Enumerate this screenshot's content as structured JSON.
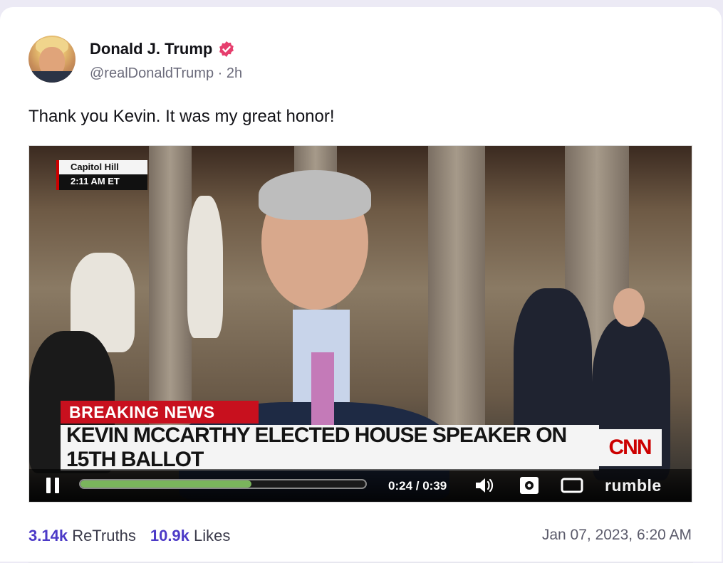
{
  "post": {
    "author_name": "Donald J. Trump",
    "handle": "@realDonaldTrump",
    "separator": "·",
    "age": "2h",
    "text": "Thank you Kevin. It was my great honor!",
    "date": "Jan 07, 2023, 6:20 AM"
  },
  "video": {
    "location_line1": "Capitol Hill",
    "location_line2": "2:11 AM ET",
    "breaking_label": "BREAKING NEWS",
    "headline": "KEVIN MCCARTHY ELECTED HOUSE SPEAKER ON 15TH BALLOT",
    "network_logo": "CNN",
    "time_display": "0:24 / 0:39",
    "progress_fraction": 0.6,
    "provider": "rumble"
  },
  "stats": {
    "retruths_count": "3.14k",
    "retruths_label": "ReTruths",
    "likes_count": "10.9k",
    "likes_label": "Likes"
  },
  "colors": {
    "accent": "#4c3ac7",
    "verified_badge": "#e63e6d",
    "progress_fill": "#7ab55c",
    "breaking_red": "#c8101e"
  },
  "icons": {
    "verified": "verified-badge-icon",
    "pause": "pause-icon",
    "volume": "volume-icon",
    "settings": "gear-icon",
    "fullscreen": "fullscreen-icon"
  }
}
